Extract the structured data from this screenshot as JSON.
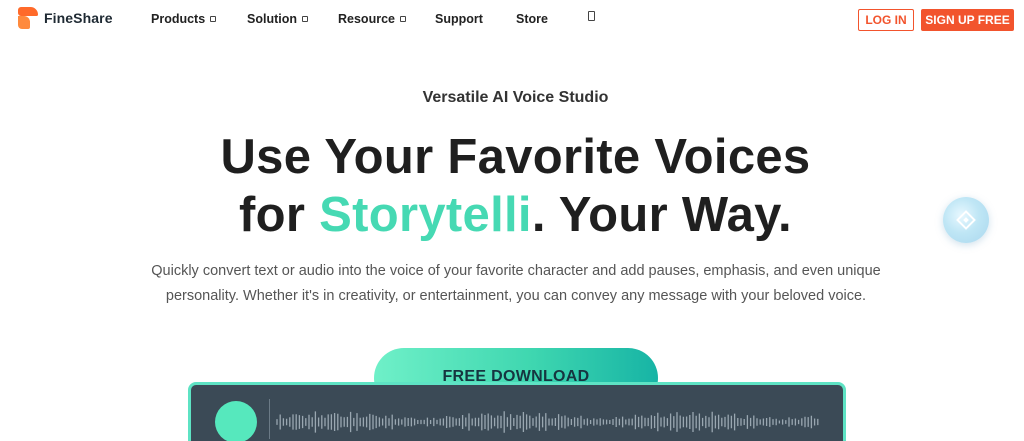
{
  "nav": {
    "logo_text": "FineShare",
    "items": [
      {
        "label": "Products",
        "has_caret": true
      },
      {
        "label": "Solution",
        "has_caret": true
      },
      {
        "label": "Resource",
        "has_caret": true
      },
      {
        "label": "Support",
        "has_caret": false
      },
      {
        "label": "Store",
        "has_caret": false
      }
    ],
    "extra_icon": "box-icon",
    "login_label": "LOG IN",
    "signup_label": "SIGN UP FREE"
  },
  "hero": {
    "eyebrow": "Versatile AI Voice Studio",
    "headline_line1": "Use Your Favorite Voices",
    "headline_line2_prefix": "for ",
    "headline_line2_accent": "Storytelli",
    "headline_line2_suffix": ". Your Way.",
    "description": "Quickly convert text or audio into the voice of your favorite character and add pauses, emphasis, and even unique personality. Whether it's in creativity, or entertainment, you can convey any message with your beloved voice.",
    "download_label": "FREE DOWNLOAD"
  },
  "player": {
    "play_icon": "play-icon",
    "waveform_icon": "waveform-icon"
  },
  "floating_widget": {
    "icon": "diamond-badge-icon"
  },
  "colors": {
    "brand_orange": "#f2542d",
    "accent_teal": "#46d9b3",
    "player_bg": "#3b4a56"
  }
}
